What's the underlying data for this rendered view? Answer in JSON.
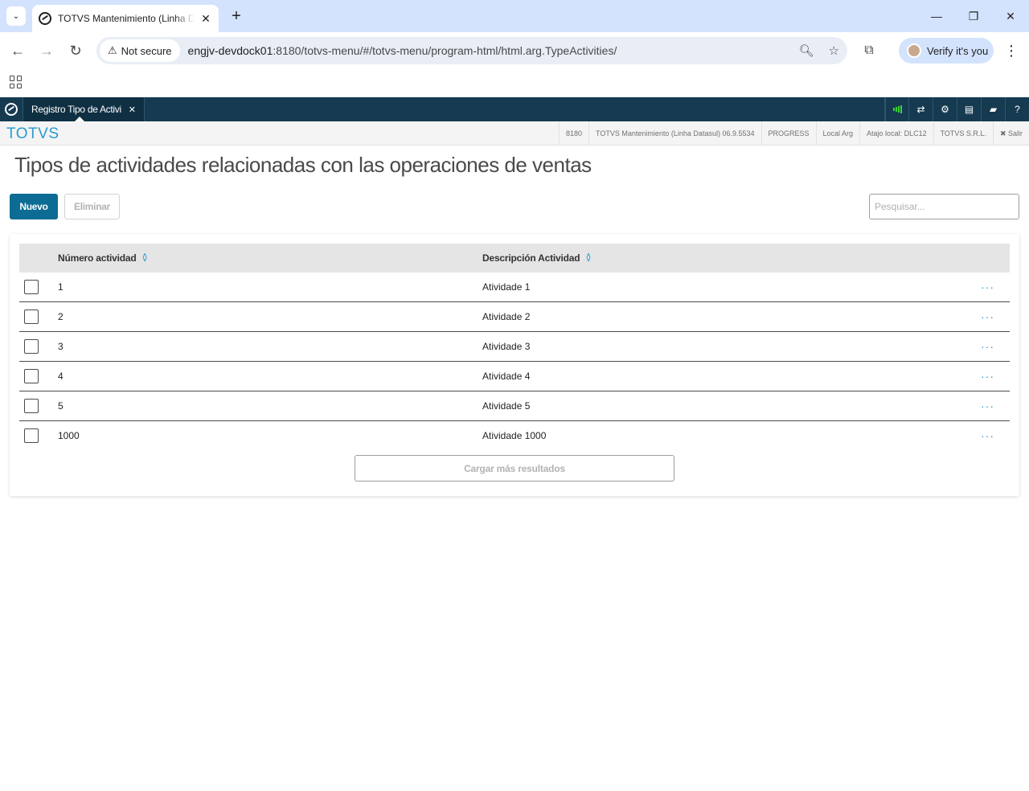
{
  "browser": {
    "tab_title": "TOTVS Mantenimiento (Linha Datasul)",
    "security_label": "Not secure",
    "url_host": "engjv-devdock01",
    "url_rest": ":8180/totvs-menu/#/totvs-menu/program-html/html.arg.TypeActivities/",
    "profile_label": "Verify it's you"
  },
  "app": {
    "tab_label": "Registro Tipo de Activi",
    "brand": "TOTVS",
    "info": [
      "8180",
      "TOTVS Mantenimiento (Linha Datasul) 06.9.5534",
      "PROGRESS",
      "Local Arg",
      "Atajo local: DLC12",
      "TOTVS S.R.L.",
      "✖ Salir"
    ]
  },
  "page": {
    "title": "Tipos de actividades relacionadas con las operaciones de ventas",
    "new_label": "Nuevo",
    "delete_label": "Eliminar",
    "search_placeholder": "Pesquisar...",
    "columns": [
      "Número actividad",
      "Descripción Actividad"
    ],
    "rows": [
      {
        "numero": "1",
        "descripcion": "Atividade 1"
      },
      {
        "numero": "2",
        "descripcion": "Atividade 2"
      },
      {
        "numero": "3",
        "descripcion": "Atividade 3"
      },
      {
        "numero": "4",
        "descripcion": "Atividade 4"
      },
      {
        "numero": "5",
        "descripcion": "Atividade 5"
      },
      {
        "numero": "1000",
        "descripcion": "Atividade 1000"
      }
    ],
    "load_more_label": "Cargar más resultados"
  },
  "colors": {
    "app_header": "#163b51",
    "primary_button": "#0c6c94",
    "brand_accent": "#2a9bcf"
  },
  "icons": [
    "tab-search-icon",
    "favicon-icon",
    "close-icon",
    "plus-icon",
    "minimize-icon",
    "restore-icon",
    "back-icon",
    "forward-icon",
    "reload-icon",
    "warning-icon",
    "zoom-icon",
    "star-icon",
    "extensions-icon",
    "menu-kebab-icon",
    "apps-grid-icon",
    "signal-icon",
    "shuffle-icon",
    "gear-icon",
    "document-icon",
    "chat-icon",
    "help-icon",
    "sort-icon",
    "more-actions-icon"
  ]
}
